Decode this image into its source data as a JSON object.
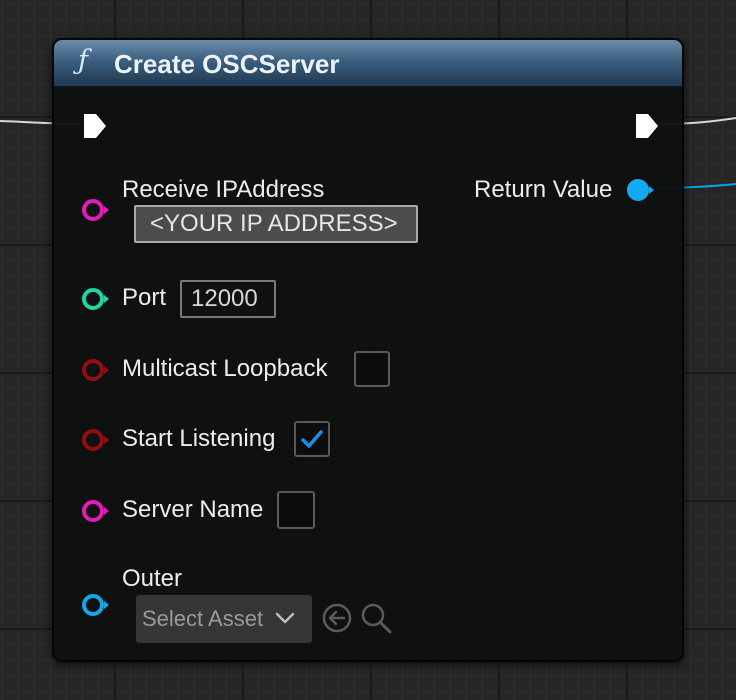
{
  "node": {
    "function_icon": "ƒ",
    "title": "Create OSCServer"
  },
  "pins": {
    "receive_ip": {
      "label": "Receive IPAddress",
      "value": "<YOUR IP ADDRESS>",
      "pin_color": "#e619ba"
    },
    "port": {
      "label": "Port",
      "value": "12000",
      "pin_color": "#1fd6a0"
    },
    "multicast_loopback": {
      "label": "Multicast Loopback",
      "checked": false,
      "pin_color": "#930f0f"
    },
    "start_listening": {
      "label": "Start Listening",
      "checked": true,
      "pin_color": "#930f0f"
    },
    "server_name": {
      "label": "Server Name",
      "checked": false,
      "pin_color": "#e619ba"
    },
    "outer": {
      "label": "Outer",
      "select_placeholder": "Select Asset",
      "pin_color": "#14a6ea"
    },
    "return_value": {
      "label": "Return Value",
      "pin_color": "#12a8f2"
    }
  },
  "colors": {
    "header_top": "#6c8ca8",
    "header_bottom": "#21384f",
    "exec_pin": "#ffffff",
    "checkmark": "#1e8de8"
  },
  "icons": {
    "exec_in": "exec-in-pin-icon",
    "exec_out": "exec-out-pin-icon",
    "use_selected": "arrow-left-circle-icon",
    "browse": "magnifier-icon",
    "dropdown": "chevron-down-icon"
  }
}
